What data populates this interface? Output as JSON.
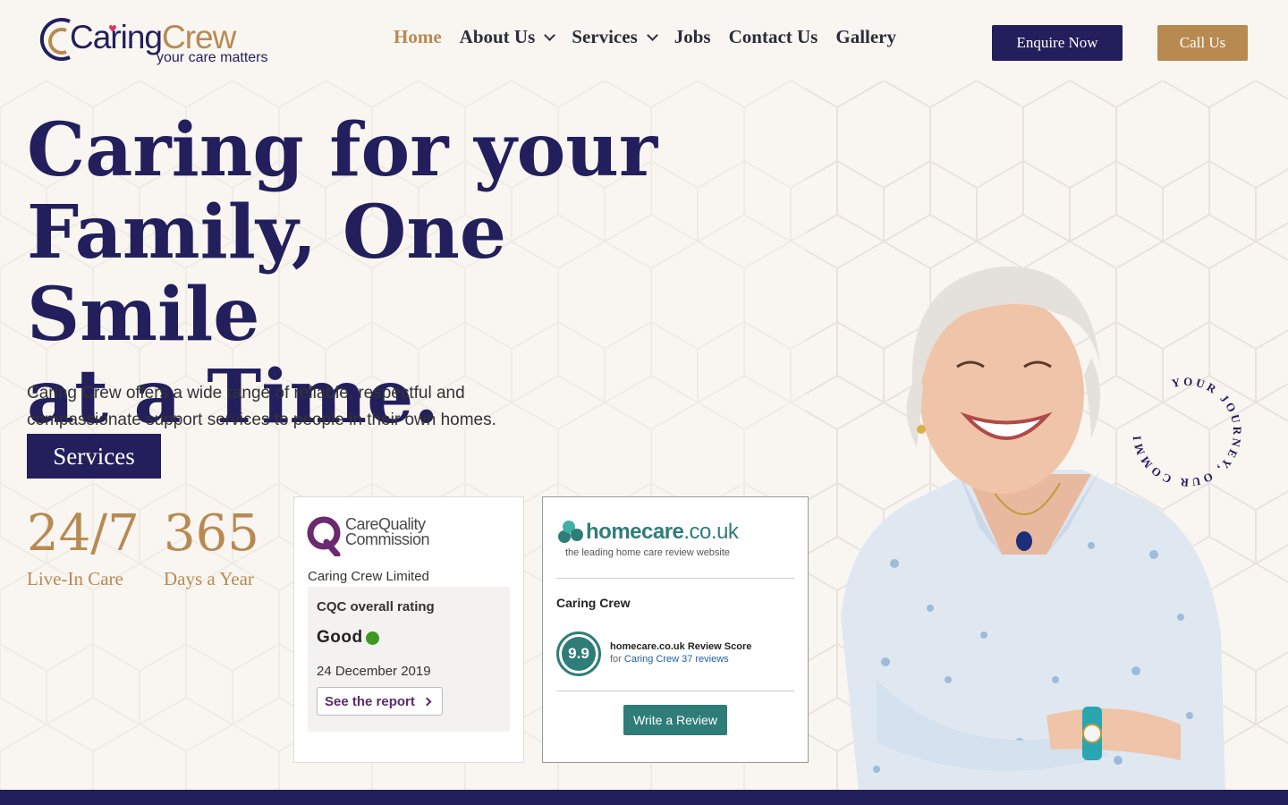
{
  "brand": {
    "name_part1": "Caring",
    "name_part2": "Crew",
    "tagline": "your care matters"
  },
  "nav": {
    "items": [
      {
        "label": "Home",
        "active": true,
        "dropdown": false
      },
      {
        "label": "About Us",
        "active": false,
        "dropdown": true
      },
      {
        "label": "Services",
        "active": false,
        "dropdown": true
      },
      {
        "label": "Jobs",
        "active": false,
        "dropdown": false
      },
      {
        "label": "Contact Us",
        "active": false,
        "dropdown": false
      },
      {
        "label": "Gallery",
        "active": false,
        "dropdown": false
      }
    ],
    "enquire_label": "Enquire Now",
    "call_label": "Call Us"
  },
  "hero": {
    "title_line1": "Caring for your",
    "title_line2": "Family, One Smile",
    "title_line3": "at a Time.",
    "subtitle": "Caring Crew offers a wide range of reliable, respectful and compassionate support services to people in their own homes.",
    "services_button": "Services",
    "circle_text": "YOUR JOURNEY, OUR COMMITMENT,"
  },
  "stats": [
    {
      "value": "24/7",
      "label": "Live-In Care"
    },
    {
      "value": "365",
      "label": "Days a Year"
    }
  ],
  "cqc": {
    "logo_line1": "CareQuality",
    "logo_line2": "Commission",
    "company": "Caring Crew Limited",
    "heading": "CQC overall rating",
    "rating": "Good",
    "date": "24 December 2019",
    "report_label": "See the report"
  },
  "homecare": {
    "brand_bold": "homecare",
    "brand_rest": ".co.uk",
    "tagline": "the leading home care review website",
    "company": "Caring Crew",
    "score": "9.9",
    "score_title": "homecare.co.uk Review Score",
    "score_for": "for",
    "score_link": "Caring Crew 37 reviews",
    "review_button": "Write a Review"
  },
  "colors": {
    "navy": "#231f5c",
    "gold": "#b88a52",
    "teal": "#2f7d78",
    "cqc_green": "#3d9a20",
    "background": "#f9f6f2"
  }
}
